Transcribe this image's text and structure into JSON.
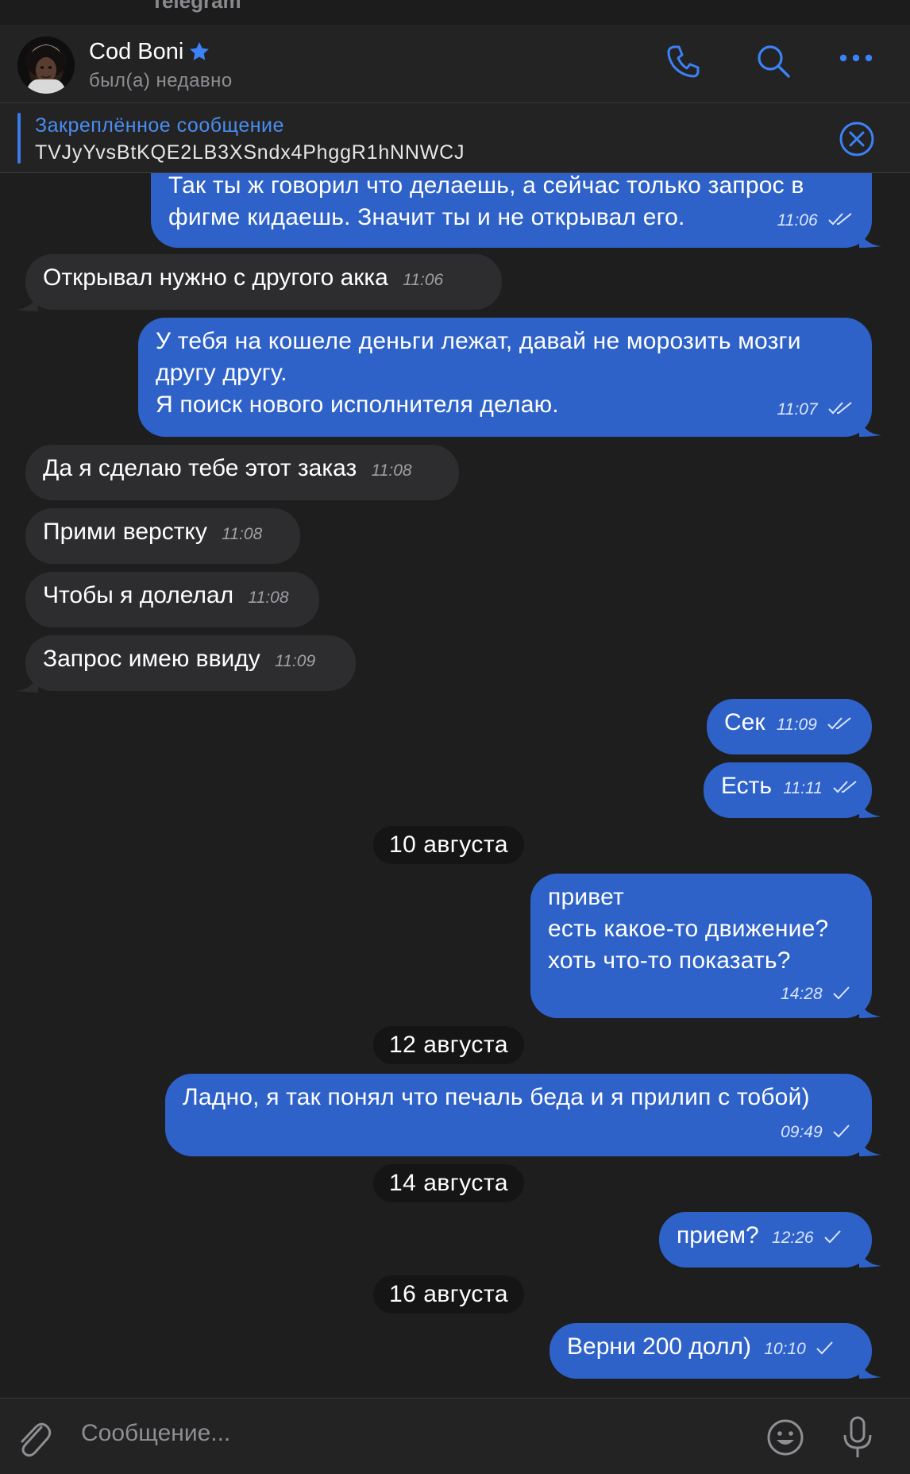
{
  "app": {
    "title": "Telegram"
  },
  "header": {
    "name": "Cod Boni",
    "status": "был(а) недавно"
  },
  "pinned": {
    "title": "Закреплённое сообщение",
    "text": "TVJyYvsBtKQE2LB3XSndx4PhggR1hNNWCJ"
  },
  "messages": {
    "m1": {
      "lines": [
        "Так ты ж говорил что делаешь, а сейчас только запрос в",
        "фигме кидаешь. Значит ты и не открывал его."
      ],
      "time": "11:06"
    },
    "m2": {
      "text": "Открывал нужно с другого акка",
      "time": "11:06"
    },
    "m3": {
      "lines": [
        "У тебя на кошеле деньги лежат, давай не морозить мозги",
        "другу другу.",
        "Я поиск нового исполнителя делаю."
      ],
      "time": "11:07"
    },
    "m4": {
      "text": "Да я сделаю тебе этот заказ",
      "time": "11:08"
    },
    "m5": {
      "text": "Прими верстку",
      "time": "11:08"
    },
    "m6": {
      "text": "Чтобы я долелал",
      "time": "11:08"
    },
    "m7": {
      "text": "Запрос имею ввиду",
      "time": "11:09"
    },
    "m8": {
      "text": "Сек",
      "time": "11:09"
    },
    "m9": {
      "text": "Есть",
      "time": "11:11"
    },
    "d1": "10 августа",
    "m10": {
      "lines": [
        "привет",
        "есть какое-то движение?",
        "хоть что-то показать?"
      ],
      "time": "14:28"
    },
    "d2": "12 августа",
    "m11": {
      "text": "Ладно, я так понял что печаль беда и я прилип с тобой)",
      "time": "09:49"
    },
    "d3": "14 августа",
    "m12": {
      "text": "прием?",
      "time": "12:26"
    },
    "d4": "16 августа",
    "m13": {
      "text": "Верни 200 долл)",
      "time": "10:10"
    }
  },
  "composer": {
    "placeholder": "Сообщение..."
  },
  "icons": {
    "call": "phone-icon",
    "search": "search-icon",
    "more": "more-icon",
    "attach": "paperclip-icon",
    "emoji": "emoji-icon",
    "mic": "microphone-icon",
    "close": "close-circle-icon",
    "verified": "star-icon"
  },
  "colors": {
    "accent": "#3b7be6",
    "outgoing_bubble": "#2e62c9",
    "incoming_bubble": "#2d2d2f",
    "background": "#1e1e1f"
  }
}
